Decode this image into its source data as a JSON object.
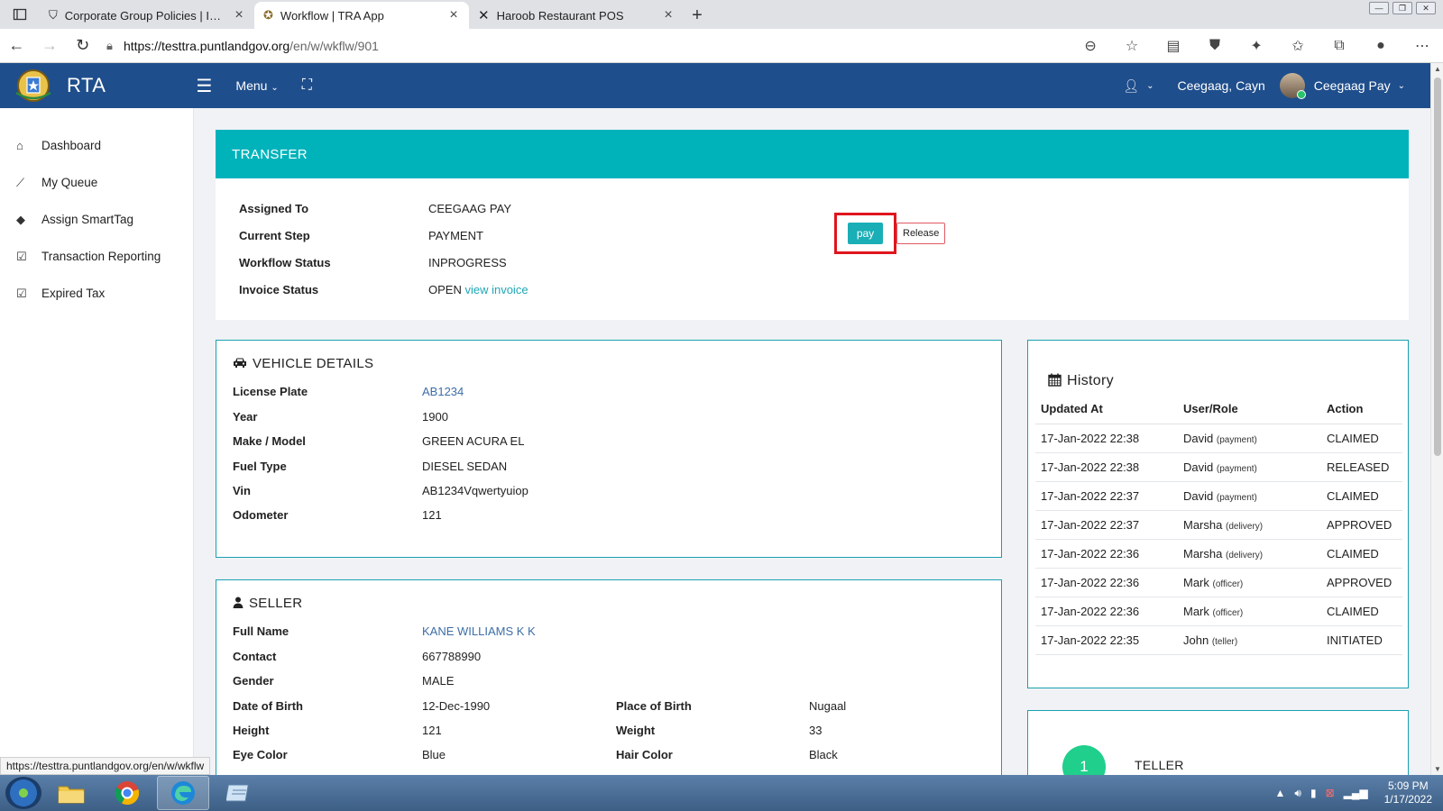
{
  "browser": {
    "tabs": [
      {
        "label": "Corporate Group Policies | Insura",
        "active": false
      },
      {
        "label": "Workflow | TRA App",
        "active": true
      },
      {
        "label": "Haroob Restaurant POS",
        "active": false
      }
    ],
    "url_host": "https://testtra.puntlandgov.org",
    "url_path": "/en/w/wkflw/901",
    "status_url": "https://testtra.puntlandgov.org/en/w/wkflw"
  },
  "header": {
    "brand": "RTA",
    "menu_label": "Menu",
    "user_name": "Ceegaag, Cayn",
    "account_label": "Ceegaag Pay"
  },
  "sidebar": {
    "items": [
      {
        "label": "Dashboard",
        "icon": "home-icon"
      },
      {
        "label": "My Queue",
        "icon": "trend-icon"
      },
      {
        "label": "Assign SmartTag",
        "icon": "tags-icon"
      },
      {
        "label": "Transaction Reporting",
        "icon": "check-square-icon"
      },
      {
        "label": "Expired Tax",
        "icon": "check-square-icon"
      }
    ]
  },
  "transfer": {
    "title": "TRANSFER",
    "fields": [
      {
        "label": "Assigned To",
        "value": "CEEGAAG PAY"
      },
      {
        "label": "Current Step",
        "value": "PAYMENT"
      },
      {
        "label": "Workflow Status",
        "value": "INPROGRESS"
      },
      {
        "label": "Invoice Status",
        "value": "OPEN"
      }
    ],
    "invoice_link": "view invoice",
    "pay_label": "pay",
    "release_label": "Release"
  },
  "vehicle": {
    "title": "VEHICLE DETAILS",
    "fields": [
      {
        "label": "License Plate",
        "value": "AB1234"
      },
      {
        "label": "Year",
        "value": "1900"
      },
      {
        "label": "Make / Model",
        "value": "GREEN ACURA EL"
      },
      {
        "label": "Fuel Type",
        "value": "DIESEL SEDAN"
      },
      {
        "label": "Vin",
        "value": "AB1234Vqwertyuiop"
      },
      {
        "label": "Odometer",
        "value": "121"
      }
    ]
  },
  "seller": {
    "title": "SELLER",
    "full_name_label": "Full Name",
    "full_name": "KANE WILLIAMS K K",
    "contact_label": "Contact",
    "contact": "667788990",
    "gender_label": "Gender",
    "gender": "MALE",
    "dob_label": "Date of Birth",
    "dob": "12-Dec-1990",
    "pob_label": "Place of Birth",
    "pob": "Nugaal",
    "height_label": "Height",
    "height": "121",
    "weight_label": "Weight",
    "weight": "33",
    "eye_label": "Eye Color",
    "eye": "Blue",
    "hair_label": "Hair Color",
    "hair": "Black"
  },
  "history": {
    "title": "History",
    "columns": [
      "Updated At",
      "User/Role",
      "Action"
    ],
    "rows": [
      {
        "at": "17-Jan-2022 22:38",
        "user": "David",
        "role": "(payment)",
        "action": "CLAIMED"
      },
      {
        "at": "17-Jan-2022 22:38",
        "user": "David",
        "role": "(payment)",
        "action": "RELEASED"
      },
      {
        "at": "17-Jan-2022 22:37",
        "user": "David",
        "role": "(payment)",
        "action": "CLAIMED"
      },
      {
        "at": "17-Jan-2022 22:37",
        "user": "Marsha",
        "role": "(delivery)",
        "action": "APPROVED"
      },
      {
        "at": "17-Jan-2022 22:36",
        "user": "Marsha",
        "role": "(delivery)",
        "action": "CLAIMED"
      },
      {
        "at": "17-Jan-2022 22:36",
        "user": "Mark",
        "role": "(officer)",
        "action": "APPROVED"
      },
      {
        "at": "17-Jan-2022 22:36",
        "user": "Mark",
        "role": "(officer)",
        "action": "CLAIMED"
      },
      {
        "at": "17-Jan-2022 22:35",
        "user": "John",
        "role": "(teller)",
        "action": "INITIATED"
      }
    ]
  },
  "steps": {
    "number": "1",
    "label": "TELLER"
  },
  "taskbar": {
    "time": "5:09 PM",
    "date": "1/17/2022"
  },
  "colors": {
    "header_bg": "#1f4e8c",
    "accent_teal": "#00b3bb",
    "highlight_red": "#e0151d",
    "step_green": "#1fcf8b"
  }
}
